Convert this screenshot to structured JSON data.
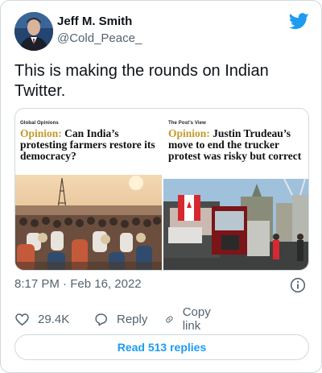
{
  "author": {
    "display_name": "Jeff M. Smith",
    "handle": "@Cold_Peace_",
    "avatar_icon": "user-avatar"
  },
  "brand": {
    "icon": "twitter-bird-icon",
    "color": "#1d9bf0"
  },
  "tweet": {
    "text": "This is making the rounds on Indian Twitter."
  },
  "media": {
    "left": {
      "kicker": "Global Opinions",
      "headline_prefix": "Opinion:",
      "headline_rest": " Can India’s protesting farmers restore its democracy?"
    },
    "right": {
      "kicker": "The Post’s View",
      "headline_prefix": "Opinion:",
      "headline_rest": " Justin Trudeau’s move to end the trucker protest was risky but correct"
    }
  },
  "meta": {
    "time": "8:17 PM",
    "separator": " · ",
    "date": "Feb 16, 2022",
    "info_icon": "info-icon"
  },
  "actions": {
    "like_icon": "heart-icon",
    "like_count": "29.4K",
    "reply_icon": "reply-bubble-icon",
    "reply_label": "Reply",
    "copy_icon": "link-icon",
    "copy_label": "Copy link"
  },
  "footer": {
    "read_replies_label": "Read 513 replies"
  },
  "colors": {
    "text": "#0f1419",
    "secondary": "#536471",
    "accent": "#1d9bf0",
    "opinion_gold": "#c49a2c",
    "border": "#cfd9de"
  }
}
